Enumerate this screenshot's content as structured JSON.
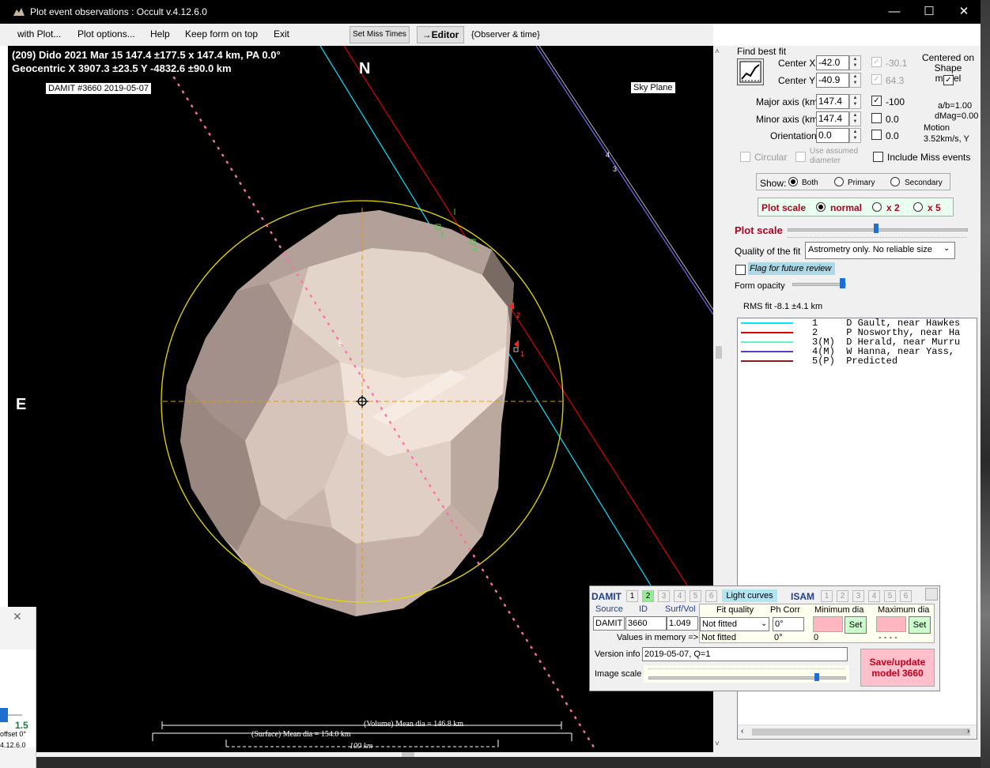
{
  "window": {
    "title": "Plot event observations : Occult v.4.12.6.0",
    "minimize": "—",
    "maximize": "☐",
    "close": "✕"
  },
  "menu": {
    "items": [
      "with Plot...",
      "Plot options...",
      "Help",
      "Keep form on top",
      "Exit"
    ],
    "set_miss_times": "Set Miss Times",
    "editor": "→Editor",
    "observer_time": "{Observer & time}"
  },
  "plot": {
    "header_line1": "(209) Dido  2021 Mar 15   147.4 ±177.5 x 147.4 km, PA 0.0°",
    "header_line2": "Geocentric  X  3907.3 ±23.5  Y -4832.6 ±90.0 km",
    "damit_label": "DAMIT #3660 2019-05-07",
    "sky_plane": "Sky Plane",
    "north": "N",
    "east": "E",
    "chord_labels": [
      "1",
      "2",
      "1",
      "2",
      "5",
      "4",
      "3"
    ],
    "volume_dia": "(Volume) Mean dia = 146.8 km",
    "surface_dia": "(Surface) Mean dia = 154.0 km",
    "scale_bar": "100 km"
  },
  "panel": {
    "find_best_fit": "Find best fit",
    "center_x_label": "Center X",
    "center_x": "-42.0",
    "center_x_fit": "-30.1",
    "center_y_label": "Center Y",
    "center_y": "-40.9",
    "center_y_fit": "64.3",
    "centered_on": "Centered on Shape model",
    "major_label": "Major axis (km)",
    "major": "147.4",
    "major_fit": "-100",
    "minor_label": "Minor axis (km)",
    "minor": "147.4",
    "minor_fit": "0.0",
    "orient_label": "Orientation",
    "orient": "0.0",
    "orient_fit": "0.0",
    "ab": "a/b=1.00",
    "dmag": "dMag=0.00",
    "motion": "Motion",
    "motion_val": "3.52km/s, Y",
    "circular": "Circular",
    "use_assumed": "Use assumed diameter",
    "include_miss": "Include Miss events",
    "show_label": "Show:",
    "show_both": "Both",
    "show_primary": "Primary",
    "show_secondary": "Secondary",
    "plot_scale_label": "Plot scale",
    "scale_normal": "normal",
    "scale_x2": "x 2",
    "scale_x5": "x 5",
    "plot_scale_slider": "Plot scale",
    "quality_label": "Quality of the fit",
    "quality_value": "Astrometry only. No reliable size",
    "flag_review": "Flag for future review",
    "form_opacity": "Form opacity",
    "rms_fit": "RMS fit -8.1 ±4.1 km",
    "legend": [
      {
        "color": "#00e5ff",
        "text": "1     D Gault, near Hawkes"
      },
      {
        "color": "#e00000",
        "text": "2     P Nosworthy, near Ha"
      },
      {
        "color": "#66f0c0",
        "text": "3(M)  D Herald, near Murru"
      },
      {
        "color": "#5a3cc8",
        "text": "4(M)  W Hanna, near Yass,"
      },
      {
        "color": "#8b1a1a",
        "text": "5(P)  Predicted"
      }
    ]
  },
  "damit": {
    "damit": "DAMIT",
    "tabs": [
      "1",
      "2",
      "3",
      "4",
      "5",
      "6"
    ],
    "light_curves": "Light curves",
    "isam": "ISAM",
    "isam_tabs": [
      "1",
      "2",
      "3",
      "4",
      "5",
      "6"
    ],
    "source_label": "Source",
    "id_label": "ID",
    "surfvol_label": "Surf/Vol",
    "source": "DAMIT",
    "id": "3660",
    "surfvol": "1.049",
    "fit_quality_label": "Fit quality",
    "ph_corr_label": "Ph Corr",
    "min_dia_label": "Minimum dia",
    "max_dia_label": "Maximum dia",
    "fit_quality": "Not fitted",
    "ph_corr": "0°",
    "set": "Set",
    "values_in_memory": "Values in memory =>",
    "mem_fit": "Not fitted",
    "mem_ph": "0°",
    "mem_min": "0",
    "mem_max": "- - - -",
    "version_label": "Version info",
    "version": "2019-05-07, Q=1",
    "image_scale": "Image scale",
    "save": "Save/update model 3660"
  },
  "behind": {
    "value": "1.5",
    "offset": "offset 0°",
    "version": "4.12.6.0",
    "close": "✕"
  }
}
